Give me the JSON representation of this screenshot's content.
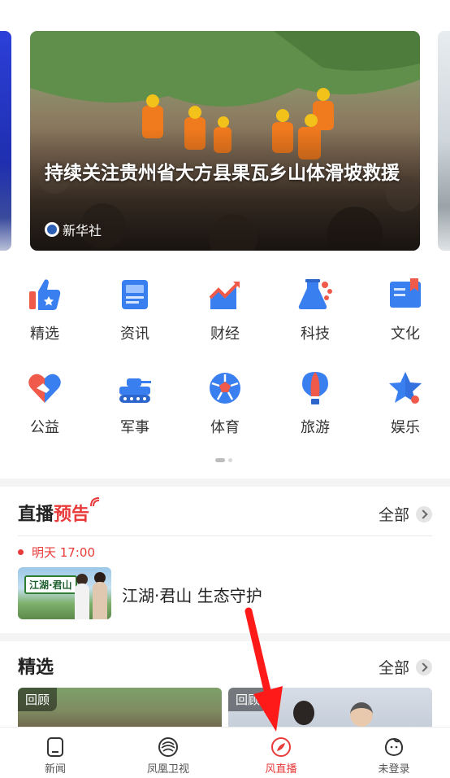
{
  "colors": {
    "accent": "#e93a3a",
    "icon_blue": "#3a7ff0",
    "icon_red": "#f05a4a"
  },
  "hero": {
    "title": "持续关注贵州省大方县果瓦乡山体滑坡救援",
    "source": "新华社"
  },
  "categories": [
    {
      "label": "精选",
      "icon": "thumbs-up-icon"
    },
    {
      "label": "资讯",
      "icon": "news-icon"
    },
    {
      "label": "财经",
      "icon": "chart-icon"
    },
    {
      "label": "科技",
      "icon": "flask-icon"
    },
    {
      "label": "文化",
      "icon": "book-icon"
    },
    {
      "label": "公益",
      "icon": "heart-handshake-icon"
    },
    {
      "label": "军事",
      "icon": "tank-icon"
    },
    {
      "label": "体育",
      "icon": "soccer-ball-icon"
    },
    {
      "label": "旅游",
      "icon": "hot-air-balloon-icon"
    },
    {
      "label": "娱乐",
      "icon": "star-icon"
    }
  ],
  "live": {
    "title_main": "直播",
    "title_accent": "预告",
    "all_label": "全部",
    "time": "明天 17:00",
    "name": "江湖·君山 生态守护",
    "thumb_tag": "江湖·君山"
  },
  "featured": {
    "title": "精选",
    "all_label": "全部",
    "items": [
      {
        "badge": "回顾"
      },
      {
        "badge": "回顾"
      }
    ]
  },
  "tabbar": [
    {
      "label": "新闻",
      "icon": "news-tab-icon",
      "active": false
    },
    {
      "label": "凤凰卫视",
      "icon": "phoenix-tv-icon",
      "active": false
    },
    {
      "label": "风直播",
      "icon": "live-compass-icon",
      "active": true
    },
    {
      "label": "未登录",
      "icon": "user-avatar-icon",
      "active": false
    }
  ]
}
